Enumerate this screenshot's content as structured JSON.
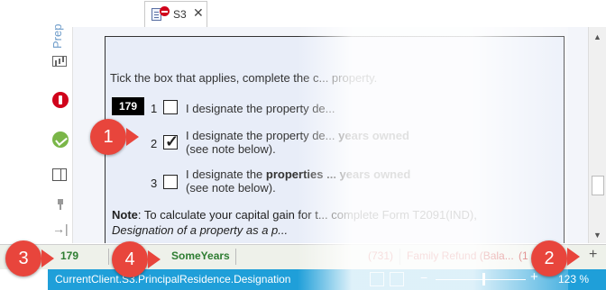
{
  "tab": {
    "label": "S3",
    "close_glyph": "✕",
    "icons": [
      "document-icon",
      "stop-icon"
    ]
  },
  "sidebar": {
    "label": "Prep"
  },
  "form": {
    "instruction": "Tick the box that applies, complete the c... property.",
    "box_number": "179",
    "options": [
      {
        "number": "1",
        "checked": false,
        "text": "I designate the property de..."
      },
      {
        "number": "2",
        "checked": true,
        "text_plain": "I designate the property de...",
        "text_bold": "years owned",
        "subtext": "(see note below)."
      },
      {
        "number": "3",
        "checked": false,
        "text_plain": "I designate the ",
        "text_bold": "properties ... years owned",
        "subtext": "(see note below)."
      }
    ],
    "note_label": "Note",
    "note_line1": ": To calculate your capital gain for t... complete Form T2091(IND),",
    "note_line2": "Designation of a property as a p..."
  },
  "fieldbar": {
    "field_number": "179",
    "field_value": "SomeYears",
    "item_a": "(731)",
    "item_b": "Family Refund (Bala...",
    "item_c": "(1",
    "add_glyph": "+"
  },
  "statusbar": {
    "path": "CurrentClient.S3.PrincipalResidence.Designation",
    "zoom_minus": "−",
    "zoom_plus": "+",
    "zoom": "123 %",
    "zoom_level_percent": 123
  },
  "callouts": [
    "1",
    "2",
    "3",
    "4"
  ],
  "colors": {
    "accent": "#1f9fd9",
    "callout": "#e8453c",
    "field_green": "#2e7d32",
    "field_red": "#c62828"
  }
}
